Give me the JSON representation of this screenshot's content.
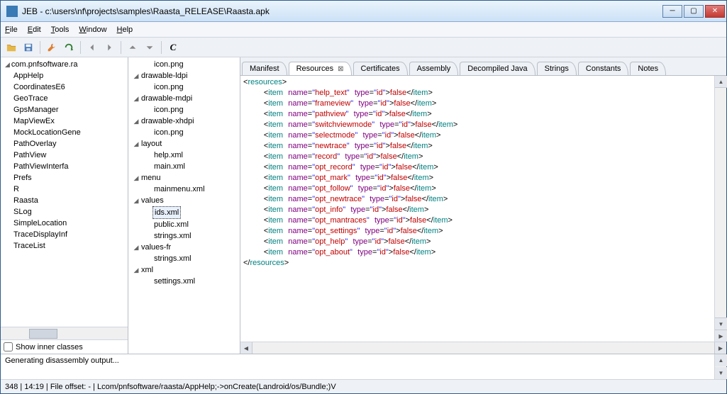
{
  "title": "JEB - c:\\users\\nf\\projects\\samples\\Raasta_RELEASE\\Raasta.apk",
  "menu": [
    "File",
    "Edit",
    "Tools",
    "Window",
    "Help"
  ],
  "checkbox_label": "Show inner classes",
  "tree1_root": "com.pnfsoftware.ra",
  "tree1": [
    "AppHelp",
    "CoordinatesE6",
    "GeoTrace",
    "GpsManager",
    "MapViewEx",
    "MockLocationGene",
    "PathOverlay",
    "PathView",
    "PathViewInterfa",
    "Prefs",
    "R",
    "Raasta",
    "SLog",
    "SimpleLocation",
    "TraceDisplayInf",
    "TraceList"
  ],
  "tree2": [
    {
      "l": 1,
      "t": "icon.png"
    },
    {
      "l": 0,
      "t": "drawable-ldpi",
      "exp": true
    },
    {
      "l": 1,
      "t": "icon.png"
    },
    {
      "l": 0,
      "t": "drawable-mdpi",
      "exp": true
    },
    {
      "l": 1,
      "t": "icon.png"
    },
    {
      "l": 0,
      "t": "drawable-xhdpi",
      "exp": true
    },
    {
      "l": 1,
      "t": "icon.png"
    },
    {
      "l": 0,
      "t": "layout",
      "exp": true
    },
    {
      "l": 1,
      "t": "help.xml"
    },
    {
      "l": 1,
      "t": "main.xml"
    },
    {
      "l": 0,
      "t": "menu",
      "exp": true
    },
    {
      "l": 1,
      "t": "mainmenu.xml"
    },
    {
      "l": 0,
      "t": "values",
      "exp": true
    },
    {
      "l": 1,
      "t": "ids.xml",
      "sel": true
    },
    {
      "l": 1,
      "t": "public.xml"
    },
    {
      "l": 1,
      "t": "strings.xml"
    },
    {
      "l": 0,
      "t": "values-fr",
      "exp": true
    },
    {
      "l": 1,
      "t": "strings.xml"
    },
    {
      "l": 0,
      "t": "xml",
      "exp": true
    },
    {
      "l": 1,
      "t": "settings.xml"
    }
  ],
  "tabs": [
    "Manifest",
    "Resources",
    "Certificates",
    "Assembly",
    "Decompiled Java",
    "Strings",
    "Constants",
    "Notes"
  ],
  "active_tab_index": 1,
  "xml_items": [
    "help_text",
    "frameview",
    "pathview",
    "switchviewmode",
    "selectmode",
    "newtrace",
    "record",
    "opt_record",
    "opt_mark",
    "opt_follow",
    "opt_newtrace",
    "opt_info",
    "opt_mantraces",
    "opt_settings",
    "opt_help",
    "opt_about"
  ],
  "xml_type": "id",
  "xml_value_literal": "false",
  "console_text": "Generating disassembly output...",
  "status_text": "348  |  14:19  |  File offset: -  |  Lcom/pnfsoftware/raasta/AppHelp;->onCreate(Landroid/os/Bundle;)V"
}
